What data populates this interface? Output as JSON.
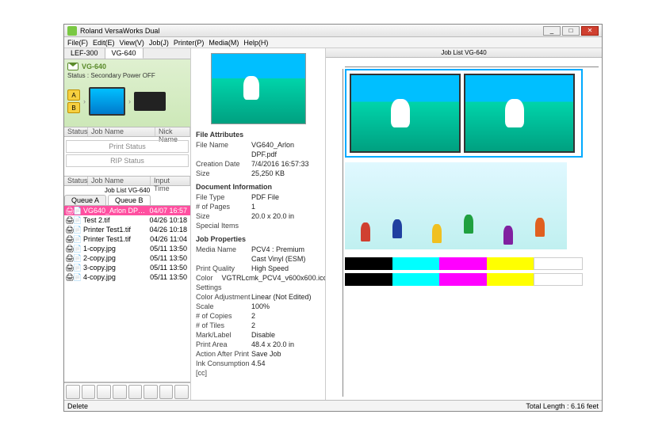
{
  "window": {
    "title": "Roland VersaWorks Dual"
  },
  "menu": [
    "File(F)",
    "Edit(E)",
    "View(V)",
    "Job(J)",
    "Printer(P)",
    "Media(M)",
    "Help(H)"
  ],
  "device_tabs": {
    "left": "LEF-300",
    "right": "VG-640"
  },
  "device": {
    "name": "VG-640",
    "status": "Status : Secondary Power OFF"
  },
  "list_header": {
    "c1": "Status",
    "c2": "Job Name",
    "c3": "Nick Name"
  },
  "status_panel": {
    "print": "Print Status",
    "rip": "RIP Status"
  },
  "job_header": {
    "c1": "Status",
    "c2": "Job Name",
    "c3": "Input Time"
  },
  "job_list_title": "Job List VG-640",
  "queues": {
    "a": "Queue A",
    "b": "Queue B"
  },
  "jobs": [
    {
      "name": "VG640_Arlon DPF.pdf",
      "time": "04/07 16:57",
      "selected": true
    },
    {
      "name": "Test 2.tif",
      "time": "04/26 10:18"
    },
    {
      "name": "Printer Test1.tif",
      "time": "04/26 10:18"
    },
    {
      "name": "Printer Test1.tif",
      "time": "04/26 11:04"
    },
    {
      "name": "1-copy.jpg",
      "time": "05/11 13:50"
    },
    {
      "name": "2-copy.jpg",
      "time": "05/11 13:50"
    },
    {
      "name": "3-copy.jpg",
      "time": "05/11 13:50"
    },
    {
      "name": "4-copy.jpg",
      "time": "05/11 13:50"
    }
  ],
  "sections": {
    "file_attr": "File Attributes",
    "doc_info": "Document Information",
    "job_props": "Job Properties"
  },
  "file_attr": [
    {
      "k": "File Name",
      "v": "VG640_Arlon DPF.pdf"
    },
    {
      "k": "Creation Date",
      "v": "7/4/2016 16:57:33"
    },
    {
      "k": "Size",
      "v": "25,250 KB"
    }
  ],
  "doc_info": [
    {
      "k": "File Type",
      "v": "PDF File"
    },
    {
      "k": "# of Pages",
      "v": "1"
    },
    {
      "k": "Size",
      "v": "20.0 x 20.0 in"
    },
    {
      "k": "Special Items",
      "v": ""
    }
  ],
  "job_props": [
    {
      "k": "Media Name",
      "v": "PCV4 : Premium Cast Vinyl (ESM)"
    },
    {
      "k": "Print Quality",
      "v": "High Speed"
    },
    {
      "k": "Color Settings",
      "v": "VGTRLcmk_PCV4_v600x600.icc"
    },
    {
      "k": "Color Adjustment",
      "v": "Linear (Not Edited)"
    },
    {
      "k": "Scale",
      "v": "100%"
    },
    {
      "k": "# of Copies",
      "v": "2"
    },
    {
      "k": "# of Tiles",
      "v": "2"
    },
    {
      "k": "Mark/Label",
      "v": "Disable"
    },
    {
      "k": "Print Area",
      "v": "48.4 x 20.0 in"
    },
    {
      "k": "Action After Print",
      "v": "Save Job"
    },
    {
      "k": "Ink Consumption [cc]",
      "v": "4.54"
    }
  ],
  "preview_title": "Job List VG-640",
  "statusbar": {
    "left": "Delete",
    "right": "Total Length : 6.16 feet"
  }
}
